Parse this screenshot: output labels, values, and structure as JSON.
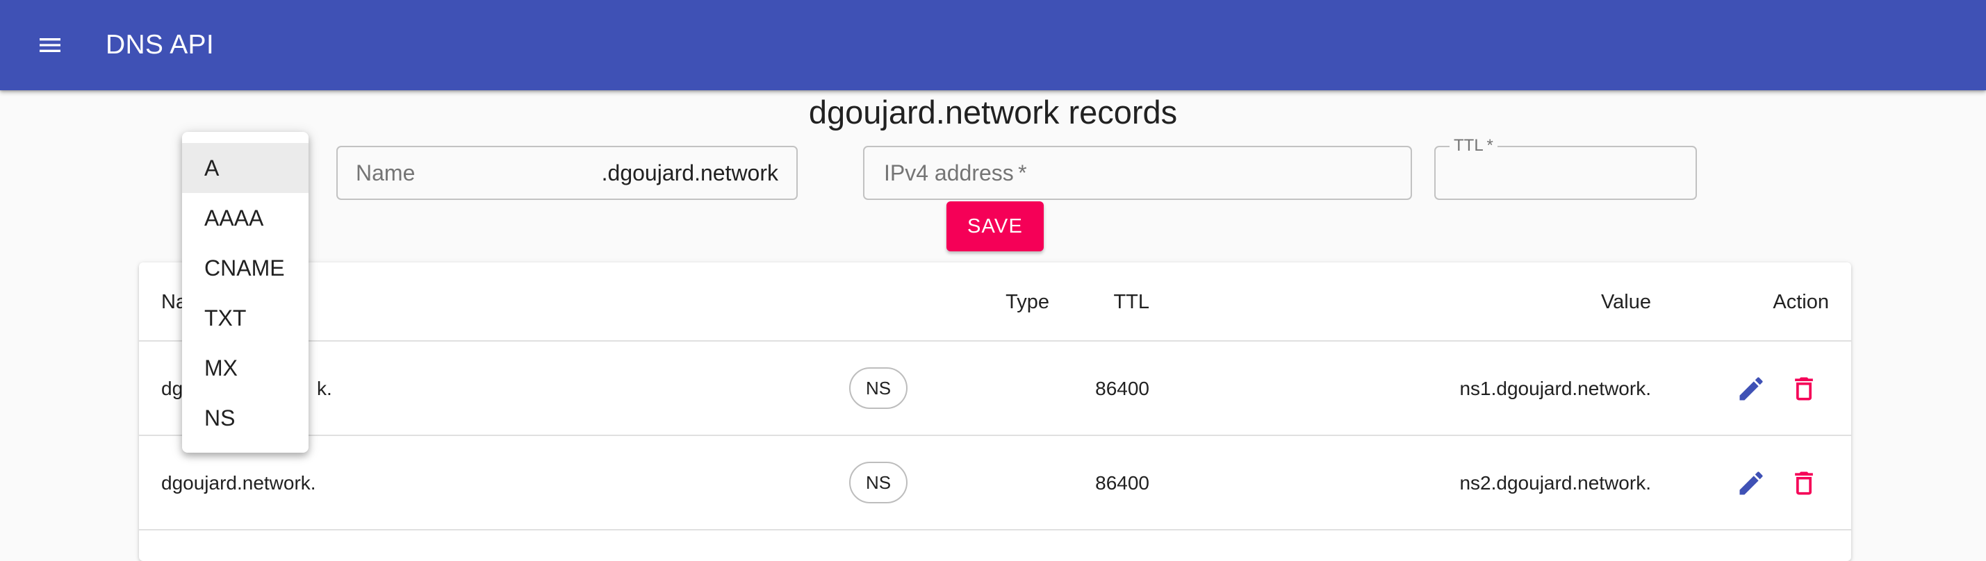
{
  "app": {
    "title": "DNS API"
  },
  "page": {
    "heading": "dgoujard.network records"
  },
  "form": {
    "type_options": [
      "A",
      "AAAA",
      "CNAME",
      "TXT",
      "MX",
      "NS"
    ],
    "selected_type": "A",
    "name_placeholder": "Name",
    "name_suffix": ".dgoujard.network",
    "value_placeholder": "IPv4 address *",
    "ttl_label": "TTL *",
    "ttl_value": "",
    "save_label": "SAVE"
  },
  "table": {
    "headers": {
      "name": "Na",
      "type": "Type",
      "ttl": "TTL",
      "value": "Value",
      "action": "Action"
    },
    "rows": [
      {
        "name": "dgoujard.network.",
        "name_visible_start": "dg",
        "name_visible_end": "k.",
        "type": "NS",
        "ttl": "86400",
        "value": "ns1.dgoujard.network."
      },
      {
        "name": "dgoujard.network.",
        "type": "NS",
        "ttl": "86400",
        "value": "ns2.dgoujard.network."
      }
    ]
  },
  "colors": {
    "primary": "#3f51b5",
    "accent": "#f50057",
    "edit_icon": "#3f51b5",
    "delete_icon": "#f50057"
  },
  "icons": {
    "menu": "menu-icon",
    "edit": "pencil-icon",
    "delete": "trash-icon"
  }
}
